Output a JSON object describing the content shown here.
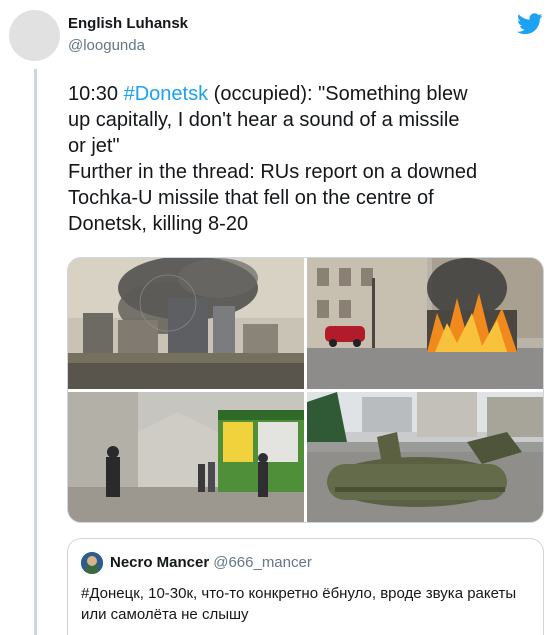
{
  "author": {
    "display_name": "English Luhansk",
    "handle": "@loogunda"
  },
  "tweet": {
    "lines": [
      {
        "prefix": "10:30 ",
        "hashtag": "#Donetsk",
        "suffix": " (occupied): \"Something blew"
      },
      {
        "text": "up capitally, I don't hear a sound of a missile"
      },
      {
        "text": "or jet\""
      },
      {
        "text": "Further in the thread: RUs report on a downed"
      },
      {
        "text": "Tochka-U missile that fell on the centre of"
      },
      {
        "text": "Donetsk, killing 8-20"
      }
    ]
  },
  "quoted_tweet": {
    "display_name": "Necro Mancer",
    "handle": "@666_mancer",
    "text": "#Донецк, 10-30к, что-то конкретно ёбнуло, вроде звука ракеты или самолёта не слышу"
  },
  "colors": {
    "brand": "#1da1f2",
    "text": "#14171a",
    "secondary": "#657786",
    "border": "#ccd6dd"
  },
  "icons": [
    "twitter-bird-icon"
  ]
}
